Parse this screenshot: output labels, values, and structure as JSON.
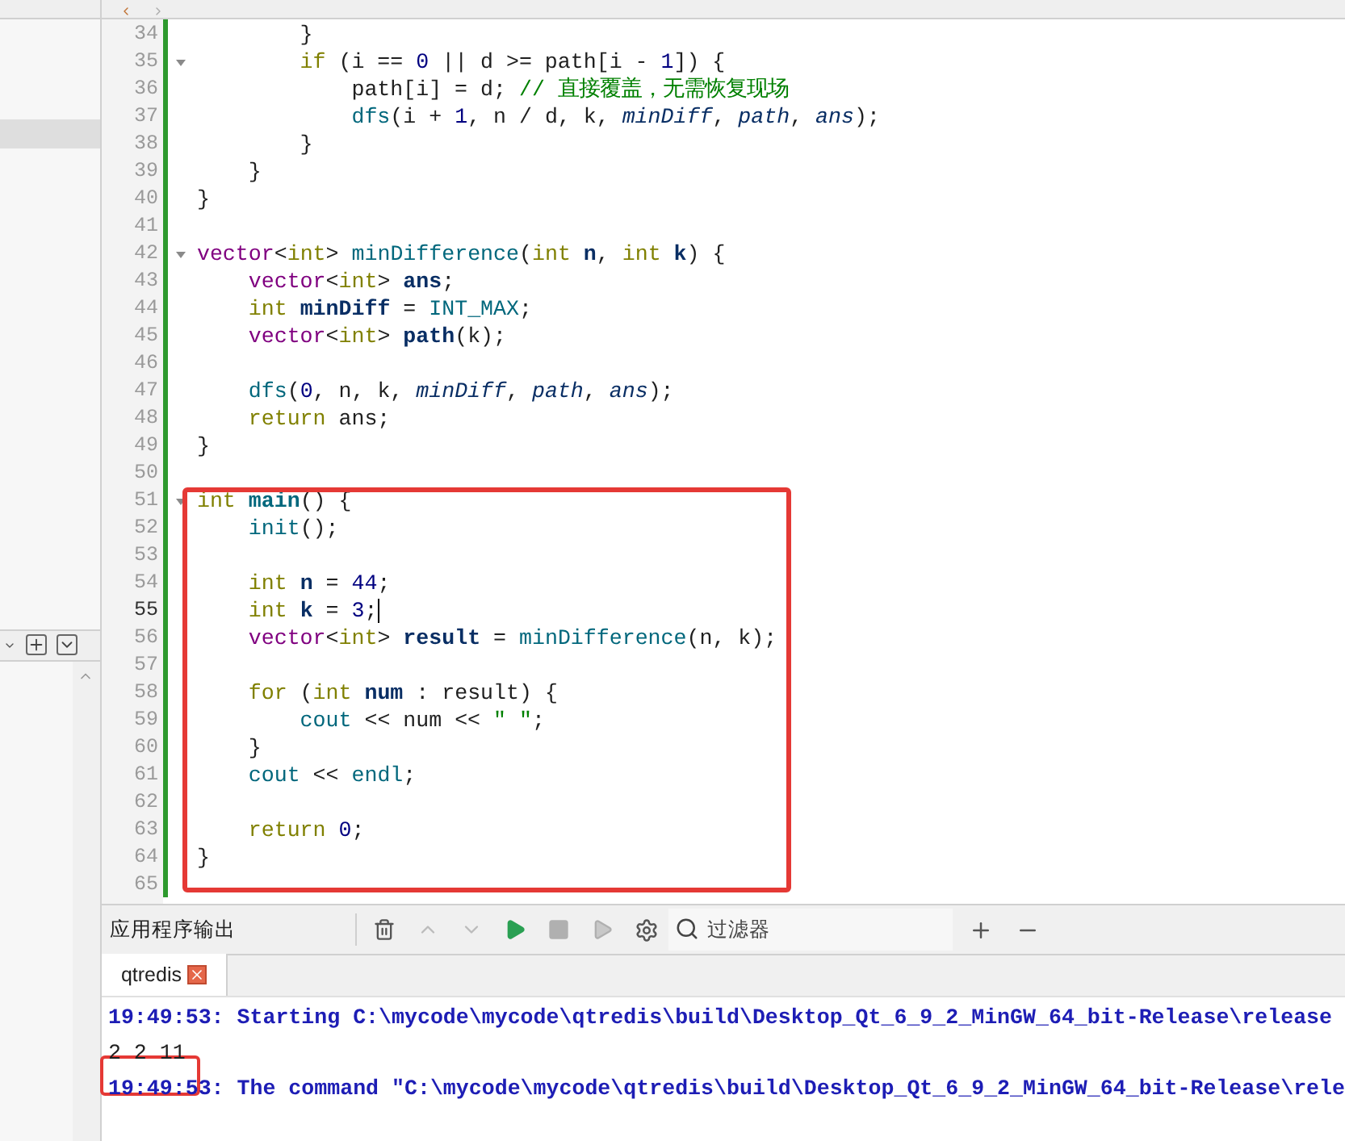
{
  "editor": {
    "lines": [
      {
        "number": "34",
        "fold": false,
        "current": false,
        "tokens": [
          {
            "text": "        }",
            "kind": "plain"
          }
        ]
      },
      {
        "number": "35",
        "fold": true,
        "current": false,
        "tokens": [
          {
            "text": "        if",
            "kind": "keyword"
          },
          {
            "text": " (i == ",
            "kind": "plain"
          },
          {
            "text": "0",
            "kind": "number"
          },
          {
            "text": " || d >= path[i - ",
            "kind": "plain"
          },
          {
            "text": "1",
            "kind": "number"
          },
          {
            "text": "]) {",
            "kind": "plain"
          }
        ]
      },
      {
        "number": "36",
        "fold": false,
        "current": false,
        "tokens": [
          {
            "text": "            path[i] = d; ",
            "kind": "plain"
          },
          {
            "text": "// 直接覆盖，无需恢复现场",
            "kind": "comment"
          }
        ]
      },
      {
        "number": "37",
        "fold": false,
        "current": false,
        "tokens": [
          {
            "text": "            dfs",
            "kind": "function"
          },
          {
            "text": "(i + ",
            "kind": "plain"
          },
          {
            "text": "1",
            "kind": "number"
          },
          {
            "text": ", n / d, k, ",
            "kind": "plain"
          },
          {
            "text": "minDiff",
            "kind": "parameter"
          },
          {
            "text": ", ",
            "kind": "plain"
          },
          {
            "text": "path",
            "kind": "parameter"
          },
          {
            "text": ", ",
            "kind": "plain"
          },
          {
            "text": "ans",
            "kind": "parameter"
          },
          {
            "text": ");",
            "kind": "plain"
          }
        ]
      },
      {
        "number": "38",
        "fold": false,
        "current": false,
        "tokens": [
          {
            "text": "        }",
            "kind": "plain"
          }
        ]
      },
      {
        "number": "39",
        "fold": false,
        "current": false,
        "tokens": [
          {
            "text": "    }",
            "kind": "plain"
          }
        ]
      },
      {
        "number": "40",
        "fold": false,
        "current": false,
        "tokens": [
          {
            "text": "}",
            "kind": "plain"
          }
        ]
      },
      {
        "number": "41",
        "fold": false,
        "current": false
      },
      {
        "number": "42",
        "fold": true,
        "current": false,
        "tokens": [
          {
            "text": "vector",
            "kind": "type"
          },
          {
            "text": "<",
            "kind": "plain"
          },
          {
            "text": "int",
            "kind": "keyword"
          },
          {
            "text": "> ",
            "kind": "plain"
          },
          {
            "text": "minDifference",
            "kind": "function"
          },
          {
            "text": "(",
            "kind": "plain"
          },
          {
            "text": "int ",
            "kind": "keyword"
          },
          {
            "text": "n",
            "kind": "declaration"
          },
          {
            "text": ", ",
            "kind": "plain"
          },
          {
            "text": "int ",
            "kind": "keyword"
          },
          {
            "text": "k",
            "kind": "declaration"
          },
          {
            "text": ") {",
            "kind": "plain"
          }
        ]
      },
      {
        "number": "43",
        "fold": false,
        "current": false,
        "tokens": [
          {
            "text": "    vector",
            "kind": "type"
          },
          {
            "text": "<",
            "kind": "plain"
          },
          {
            "text": "int",
            "kind": "keyword"
          },
          {
            "text": "> ",
            "kind": "plain"
          },
          {
            "text": "ans",
            "kind": "declaration"
          },
          {
            "text": ";",
            "kind": "plain"
          }
        ]
      },
      {
        "number": "44",
        "fold": false,
        "current": false,
        "tokens": [
          {
            "text": "    int ",
            "kind": "keyword"
          },
          {
            "text": "minDiff",
            "kind": "declaration"
          },
          {
            "text": " = ",
            "kind": "plain"
          },
          {
            "text": "INT_MAX",
            "kind": "macro"
          },
          {
            "text": ";",
            "kind": "plain"
          }
        ]
      },
      {
        "number": "45",
        "fold": false,
        "current": false,
        "tokens": [
          {
            "text": "    vector",
            "kind": "type"
          },
          {
            "text": "<",
            "kind": "plain"
          },
          {
            "text": "int",
            "kind": "keyword"
          },
          {
            "text": "> ",
            "kind": "plain"
          },
          {
            "text": "path",
            "kind": "declaration"
          },
          {
            "text": "(k);",
            "kind": "plain"
          }
        ]
      },
      {
        "number": "46",
        "fold": false,
        "current": false
      },
      {
        "number": "47",
        "fold": false,
        "current": false,
        "tokens": [
          {
            "text": "    dfs",
            "kind": "function"
          },
          {
            "text": "(",
            "kind": "plain"
          },
          {
            "text": "0",
            "kind": "number"
          },
          {
            "text": ", n, k, ",
            "kind": "plain"
          },
          {
            "text": "minDiff",
            "kind": "parameter"
          },
          {
            "text": ", ",
            "kind": "plain"
          },
          {
            "text": "path",
            "kind": "parameter"
          },
          {
            "text": ", ",
            "kind": "plain"
          },
          {
            "text": "ans",
            "kind": "parameter"
          },
          {
            "text": ");",
            "kind": "plain"
          }
        ]
      },
      {
        "number": "48",
        "fold": false,
        "current": false,
        "tokens": [
          {
            "text": "    return",
            "kind": "keyword"
          },
          {
            "text": " ans;",
            "kind": "plain"
          }
        ]
      },
      {
        "number": "49",
        "fold": false,
        "current": false,
        "tokens": [
          {
            "text": "}",
            "kind": "plain"
          }
        ]
      },
      {
        "number": "50",
        "fold": false,
        "current": false
      },
      {
        "number": "51",
        "fold": true,
        "current": false,
        "tokens": [
          {
            "text": "int ",
            "kind": "keyword"
          },
          {
            "text": "main",
            "kind": "function_definition"
          },
          {
            "text": "() {",
            "kind": "plain"
          }
        ]
      },
      {
        "number": "52",
        "fold": false,
        "current": false,
        "tokens": [
          {
            "text": "    init",
            "kind": "function"
          },
          {
            "text": "();",
            "kind": "plain"
          }
        ]
      },
      {
        "number": "53",
        "fold": false,
        "current": false
      },
      {
        "number": "54",
        "fold": false,
        "current": false,
        "tokens": [
          {
            "text": "    int ",
            "kind": "keyword"
          },
          {
            "text": "n",
            "kind": "declaration"
          },
          {
            "text": " = ",
            "kind": "plain"
          },
          {
            "text": "44",
            "kind": "number"
          },
          {
            "text": ";",
            "kind": "plain"
          }
        ]
      },
      {
        "number": "55",
        "fold": false,
        "current": true,
        "tokens": [
          {
            "text": "    int ",
            "kind": "keyword"
          },
          {
            "text": "k",
            "kind": "declaration"
          },
          {
            "text": " = ",
            "kind": "plain"
          },
          {
            "text": "3",
            "kind": "number"
          },
          {
            "text": ";",
            "kind": "plain"
          }
        ]
      },
      {
        "number": "56",
        "fold": false,
        "current": false,
        "tokens": [
          {
            "text": "    vector",
            "kind": "type"
          },
          {
            "text": "<",
            "kind": "plain"
          },
          {
            "text": "int",
            "kind": "keyword"
          },
          {
            "text": "> ",
            "kind": "plain"
          },
          {
            "text": "result",
            "kind": "declaration"
          },
          {
            "text": " = ",
            "kind": "plain"
          },
          {
            "text": "minDifference",
            "kind": "function"
          },
          {
            "text": "(n, k);",
            "kind": "plain"
          }
        ]
      },
      {
        "number": "57",
        "fold": false,
        "current": false
      },
      {
        "number": "58",
        "fold": false,
        "current": false,
        "tokens": [
          {
            "text": "    for",
            "kind": "keyword"
          },
          {
            "text": " (",
            "kind": "plain"
          },
          {
            "text": "int ",
            "kind": "keyword"
          },
          {
            "text": "num",
            "kind": "declaration"
          },
          {
            "text": " : result) {",
            "kind": "plain"
          }
        ]
      },
      {
        "number": "59",
        "fold": false,
        "current": false,
        "tokens": [
          {
            "text": "        cout",
            "kind": "macro"
          },
          {
            "text": " << num << ",
            "kind": "plain"
          },
          {
            "text": "\" \"",
            "kind": "string"
          },
          {
            "text": ";",
            "kind": "plain"
          }
        ]
      },
      {
        "number": "60",
        "fold": false,
        "current": false,
        "tokens": [
          {
            "text": "    }",
            "kind": "plain"
          }
        ]
      },
      {
        "number": "61",
        "fold": false,
        "current": false,
        "tokens": [
          {
            "text": "    cout",
            "kind": "macro"
          },
          {
            "text": " << ",
            "kind": "plain"
          },
          {
            "text": "endl",
            "kind": "function"
          },
          {
            "text": ";",
            "kind": "plain"
          }
        ]
      },
      {
        "number": "62",
        "fold": false,
        "current": false
      },
      {
        "number": "63",
        "fold": false,
        "current": false,
        "tokens": [
          {
            "text": "    return ",
            "kind": "keyword"
          },
          {
            "text": "0",
            "kind": "number"
          },
          {
            "text": ";",
            "kind": "plain"
          }
        ]
      },
      {
        "number": "64",
        "fold": false,
        "current": false,
        "tokens": [
          {
            "text": "}",
            "kind": "plain"
          }
        ]
      },
      {
        "number": "65",
        "fold": false,
        "current": false
      }
    ]
  },
  "output_pane": {
    "title": "应用程序输出",
    "filter": {
      "placeholder": "过滤器"
    },
    "tabs": [
      {
        "label": "qtredis",
        "selected": true
      }
    ],
    "lines": [
      {
        "kind": "message",
        "text": "19:49:53: Starting C:\\mycode\\mycode\\qtredis\\build\\Desktop_Qt_6_9_2_MinGW_64_bit-Release\\release"
      },
      {
        "kind": "stdout",
        "text": "2 2 11"
      },
      {
        "kind": "message",
        "text": "19:49:53: The command \"C:\\mycode\\mycode\\qtredis\\build\\Desktop_Qt_6_9_2_MinGW_64_bit-Release\\rele"
      }
    ]
  }
}
